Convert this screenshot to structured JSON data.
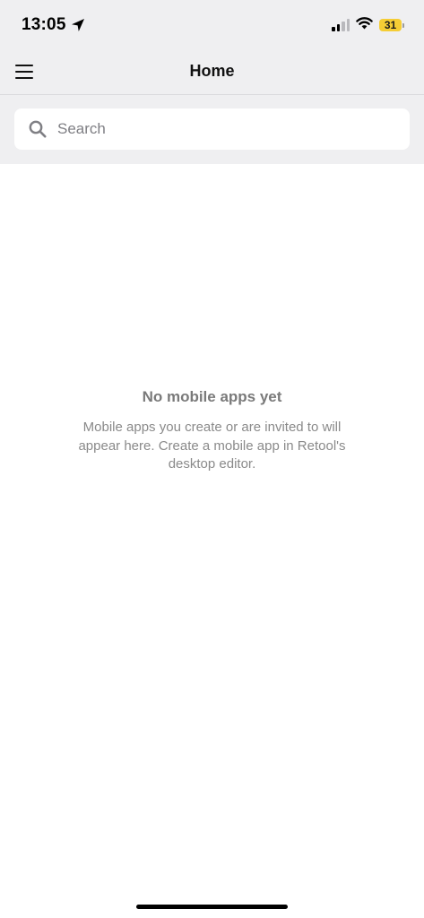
{
  "status_bar": {
    "time": "13:05",
    "battery_level": "31",
    "battery_color": "#f5cd35",
    "signal_bars_active": 2,
    "signal_bars_total": 4,
    "icons": [
      "location-arrow-icon",
      "cellular-signal-icon",
      "wifi-icon",
      "battery-icon"
    ]
  },
  "nav": {
    "title": "Home",
    "menu_icon": "hamburger-menu-icon"
  },
  "search": {
    "placeholder": "Search",
    "value": "",
    "icon": "search-icon"
  },
  "empty_state": {
    "title": "No mobile apps yet",
    "description": "Mobile apps you create or are invited to will appear here. Create a mobile app in Retool's desktop editor."
  },
  "colors": {
    "header_background": "#efeff1",
    "content_background": "#ffffff",
    "muted_text": "#8a8a8a"
  }
}
